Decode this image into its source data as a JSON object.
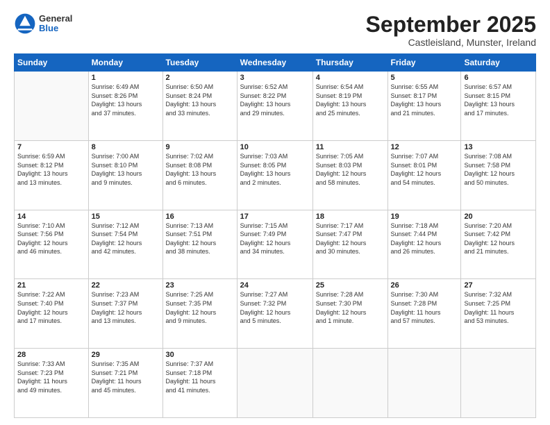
{
  "header": {
    "logo_general": "General",
    "logo_blue": "Blue",
    "month_title": "September 2025",
    "subtitle": "Castleisland, Munster, Ireland"
  },
  "days_of_week": [
    "Sunday",
    "Monday",
    "Tuesday",
    "Wednesday",
    "Thursday",
    "Friday",
    "Saturday"
  ],
  "weeks": [
    [
      {
        "day": "",
        "info": ""
      },
      {
        "day": "1",
        "info": "Sunrise: 6:49 AM\nSunset: 8:26 PM\nDaylight: 13 hours\nand 37 minutes."
      },
      {
        "day": "2",
        "info": "Sunrise: 6:50 AM\nSunset: 8:24 PM\nDaylight: 13 hours\nand 33 minutes."
      },
      {
        "day": "3",
        "info": "Sunrise: 6:52 AM\nSunset: 8:22 PM\nDaylight: 13 hours\nand 29 minutes."
      },
      {
        "day": "4",
        "info": "Sunrise: 6:54 AM\nSunset: 8:19 PM\nDaylight: 13 hours\nand 25 minutes."
      },
      {
        "day": "5",
        "info": "Sunrise: 6:55 AM\nSunset: 8:17 PM\nDaylight: 13 hours\nand 21 minutes."
      },
      {
        "day": "6",
        "info": "Sunrise: 6:57 AM\nSunset: 8:15 PM\nDaylight: 13 hours\nand 17 minutes."
      }
    ],
    [
      {
        "day": "7",
        "info": "Sunrise: 6:59 AM\nSunset: 8:12 PM\nDaylight: 13 hours\nand 13 minutes."
      },
      {
        "day": "8",
        "info": "Sunrise: 7:00 AM\nSunset: 8:10 PM\nDaylight: 13 hours\nand 9 minutes."
      },
      {
        "day": "9",
        "info": "Sunrise: 7:02 AM\nSunset: 8:08 PM\nDaylight: 13 hours\nand 6 minutes."
      },
      {
        "day": "10",
        "info": "Sunrise: 7:03 AM\nSunset: 8:05 PM\nDaylight: 13 hours\nand 2 minutes."
      },
      {
        "day": "11",
        "info": "Sunrise: 7:05 AM\nSunset: 8:03 PM\nDaylight: 12 hours\nand 58 minutes."
      },
      {
        "day": "12",
        "info": "Sunrise: 7:07 AM\nSunset: 8:01 PM\nDaylight: 12 hours\nand 54 minutes."
      },
      {
        "day": "13",
        "info": "Sunrise: 7:08 AM\nSunset: 7:58 PM\nDaylight: 12 hours\nand 50 minutes."
      }
    ],
    [
      {
        "day": "14",
        "info": "Sunrise: 7:10 AM\nSunset: 7:56 PM\nDaylight: 12 hours\nand 46 minutes."
      },
      {
        "day": "15",
        "info": "Sunrise: 7:12 AM\nSunset: 7:54 PM\nDaylight: 12 hours\nand 42 minutes."
      },
      {
        "day": "16",
        "info": "Sunrise: 7:13 AM\nSunset: 7:51 PM\nDaylight: 12 hours\nand 38 minutes."
      },
      {
        "day": "17",
        "info": "Sunrise: 7:15 AM\nSunset: 7:49 PM\nDaylight: 12 hours\nand 34 minutes."
      },
      {
        "day": "18",
        "info": "Sunrise: 7:17 AM\nSunset: 7:47 PM\nDaylight: 12 hours\nand 30 minutes."
      },
      {
        "day": "19",
        "info": "Sunrise: 7:18 AM\nSunset: 7:44 PM\nDaylight: 12 hours\nand 26 minutes."
      },
      {
        "day": "20",
        "info": "Sunrise: 7:20 AM\nSunset: 7:42 PM\nDaylight: 12 hours\nand 21 minutes."
      }
    ],
    [
      {
        "day": "21",
        "info": "Sunrise: 7:22 AM\nSunset: 7:40 PM\nDaylight: 12 hours\nand 17 minutes."
      },
      {
        "day": "22",
        "info": "Sunrise: 7:23 AM\nSunset: 7:37 PM\nDaylight: 12 hours\nand 13 minutes."
      },
      {
        "day": "23",
        "info": "Sunrise: 7:25 AM\nSunset: 7:35 PM\nDaylight: 12 hours\nand 9 minutes."
      },
      {
        "day": "24",
        "info": "Sunrise: 7:27 AM\nSunset: 7:32 PM\nDaylight: 12 hours\nand 5 minutes."
      },
      {
        "day": "25",
        "info": "Sunrise: 7:28 AM\nSunset: 7:30 PM\nDaylight: 12 hours\nand 1 minute."
      },
      {
        "day": "26",
        "info": "Sunrise: 7:30 AM\nSunset: 7:28 PM\nDaylight: 11 hours\nand 57 minutes."
      },
      {
        "day": "27",
        "info": "Sunrise: 7:32 AM\nSunset: 7:25 PM\nDaylight: 11 hours\nand 53 minutes."
      }
    ],
    [
      {
        "day": "28",
        "info": "Sunrise: 7:33 AM\nSunset: 7:23 PM\nDaylight: 11 hours\nand 49 minutes."
      },
      {
        "day": "29",
        "info": "Sunrise: 7:35 AM\nSunset: 7:21 PM\nDaylight: 11 hours\nand 45 minutes."
      },
      {
        "day": "30",
        "info": "Sunrise: 7:37 AM\nSunset: 7:18 PM\nDaylight: 11 hours\nand 41 minutes."
      },
      {
        "day": "",
        "info": ""
      },
      {
        "day": "",
        "info": ""
      },
      {
        "day": "",
        "info": ""
      },
      {
        "day": "",
        "info": ""
      }
    ]
  ]
}
